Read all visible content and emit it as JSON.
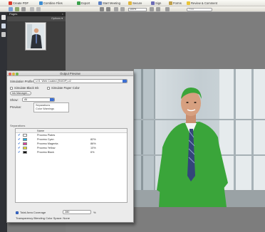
{
  "toolbar": {
    "buttons": [
      {
        "label": "Create PDF"
      },
      {
        "label": "Combine Files"
      },
      {
        "label": "Export"
      },
      {
        "label": "Start Meeting"
      },
      {
        "label": "Secure"
      },
      {
        "label": "Sign"
      },
      {
        "label": "Forms"
      },
      {
        "label": "Review & Comment"
      }
    ],
    "zoom_value": "100%",
    "find_placeholder": "Find"
  },
  "pages_panel": {
    "title": "Pages",
    "close": "×",
    "options": "Options ▾"
  },
  "dialog": {
    "title": "Output Preview",
    "simulation_profile_label": "Simulation Profile:",
    "simulation_profile_value": "U.S. Web Coated (SWOP) v2",
    "simulate_black_ink": "Simulate Black Ink",
    "simulate_paper_color": "Simulate Paper Color",
    "ink_manager": "Ink Manager...",
    "show_label": "Show:",
    "show_value": "All",
    "preview_label": "Preview:",
    "preview_options": [
      "Separations",
      "Color Warnings"
    ],
    "separations_label": "Separations",
    "name_header": "Name",
    "separations": [
      {
        "name": "Process Plates",
        "percent": "",
        "color": "#ffffff"
      },
      {
        "name": "Process Cyan",
        "percent": "82%",
        "color": "#22b3e6"
      },
      {
        "name": "Process Magenta",
        "percent": "86%",
        "color": "#e23a9c"
      },
      {
        "name": "Process Yellow",
        "percent": "10%",
        "color": "#f2e52a"
      },
      {
        "name": "Process Black",
        "percent": "6%",
        "color": "#111111"
      }
    ],
    "total_area_coverage_label": "Total Area Coverage",
    "total_area_coverage_value": "280",
    "total_area_unit": "%",
    "transparency_blending_label": "Transparency Blending Color Space:",
    "transparency_blending_value": "None"
  },
  "colors": {
    "accent_blue": "#3c6fd4",
    "highlight_green": "#3aa53a"
  }
}
